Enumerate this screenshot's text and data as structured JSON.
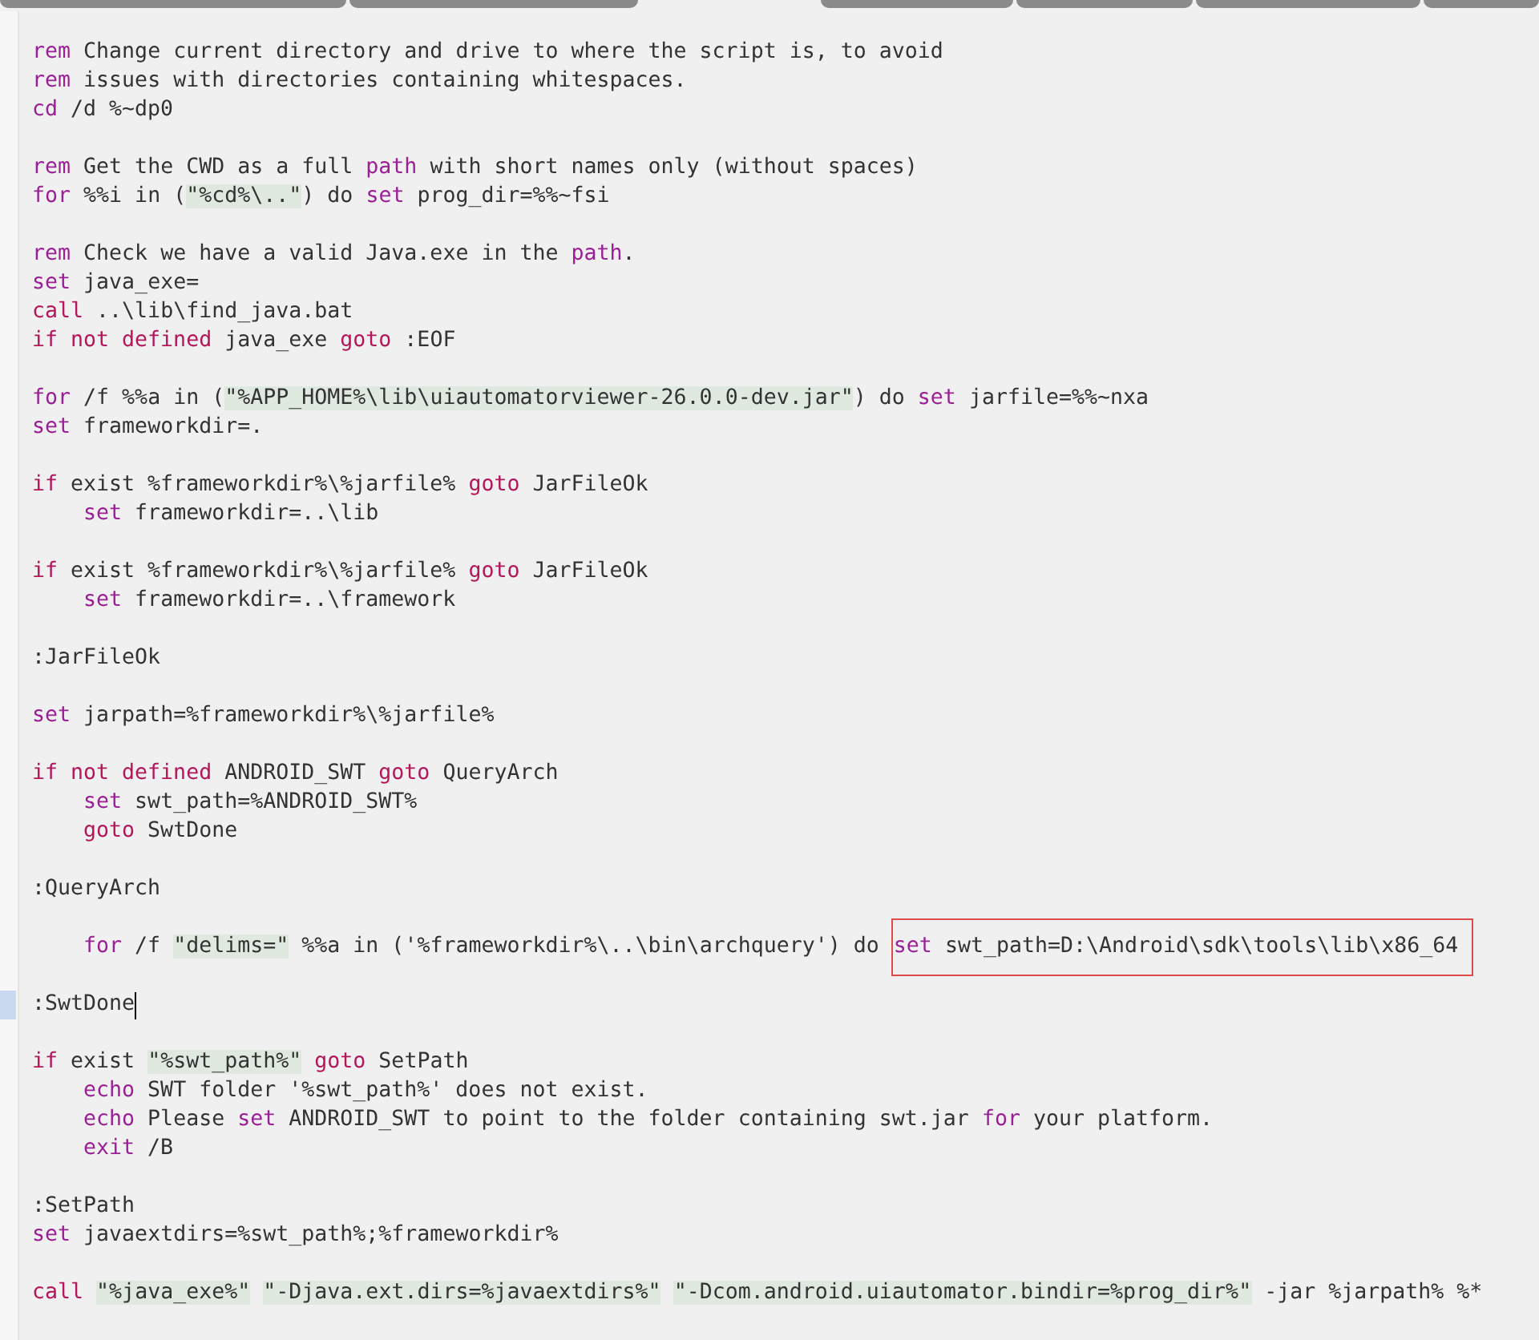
{
  "lines": [
    {
      "cursor": false,
      "indented": false,
      "tokens": [
        {
          "kind": "keyword",
          "text": "rem"
        },
        {
          "kind": "text",
          "text": " Change current directory and drive to where the script is, to avoid"
        }
      ]
    },
    {
      "cursor": false,
      "indented": false,
      "tokens": [
        {
          "kind": "keyword",
          "text": "rem"
        },
        {
          "kind": "text",
          "text": " issues with directories containing whitespaces."
        }
      ]
    },
    {
      "cursor": false,
      "indented": false,
      "tokens": [
        {
          "kind": "keyword",
          "text": "cd"
        },
        {
          "kind": "text",
          "text": " /d %~dp0"
        }
      ]
    },
    {
      "cursor": false
    },
    {
      "cursor": false,
      "indented": false,
      "tokens": [
        {
          "kind": "keyword",
          "text": "rem"
        },
        {
          "kind": "text",
          "text": " Get the CWD as a full "
        },
        {
          "kind": "keyword",
          "text": "path"
        },
        {
          "kind": "text",
          "text": " with short names only (without spaces)"
        }
      ]
    },
    {
      "cursor": false,
      "indented": false,
      "tokens": [
        {
          "kind": "keyword",
          "text": "for"
        },
        {
          "kind": "text",
          "text": " %%i in ("
        },
        {
          "kind": "string",
          "text": "\"%cd%\\..\"",
          "spaced": false
        },
        {
          "kind": "text",
          "text": ") do "
        },
        {
          "kind": "keyword",
          "text": "set"
        },
        {
          "kind": "text",
          "text": " prog_dir=%%~fsi"
        }
      ]
    },
    {
      "cursor": false
    },
    {
      "cursor": false,
      "indented": false,
      "tokens": [
        {
          "kind": "keyword",
          "text": "rem"
        },
        {
          "kind": "text",
          "text": " Check we have a valid Java.exe in the "
        },
        {
          "kind": "keyword",
          "text": "path"
        },
        {
          "kind": "text",
          "text": "."
        }
      ]
    },
    {
      "cursor": false,
      "indented": false,
      "tokens": [
        {
          "kind": "keyword",
          "text": "set"
        },
        {
          "kind": "text",
          "text": " java_exe="
        }
      ]
    },
    {
      "cursor": false,
      "indented": false,
      "tokens": [
        {
          "kind": "control",
          "text": "call"
        },
        {
          "kind": "text",
          "text": " ..\\lib\\find_java.bat"
        }
      ]
    },
    {
      "cursor": false,
      "indented": false,
      "tokens": [
        {
          "kind": "control",
          "text": "if not defined"
        },
        {
          "kind": "text",
          "text": " java_exe "
        },
        {
          "kind": "control",
          "text": "goto"
        },
        {
          "kind": "text",
          "text": " :EOF"
        }
      ]
    },
    {
      "cursor": false
    },
    {
      "cursor": false,
      "indented": false,
      "tokens": [
        {
          "kind": "keyword",
          "text": "for"
        },
        {
          "kind": "text",
          "text": " /f %%a in ("
        },
        {
          "kind": "string",
          "text": "\"%APP_HOME%\\lib\\uiautomatorviewer-26.0.0-dev.jar\"",
          "spaced": false
        },
        {
          "kind": "text",
          "text": ") do "
        },
        {
          "kind": "keyword",
          "text": "set"
        },
        {
          "kind": "text",
          "text": " jarfile=%%~nxa"
        }
      ]
    },
    {
      "cursor": false,
      "indented": false,
      "tokens": [
        {
          "kind": "keyword",
          "text": "set"
        },
        {
          "kind": "text",
          "text": " frameworkdir=."
        }
      ]
    },
    {
      "cursor": false
    },
    {
      "cursor": false,
      "indented": false,
      "tokens": [
        {
          "kind": "control",
          "text": "if"
        },
        {
          "kind": "text",
          "text": " exist %frameworkdir%\\%jarfile% "
        },
        {
          "kind": "control",
          "text": "goto"
        },
        {
          "kind": "text",
          "text": " JarFileOk"
        }
      ]
    },
    {
      "cursor": false,
      "indented": true,
      "tokens": [
        {
          "kind": "keyword",
          "text": "set"
        },
        {
          "kind": "text",
          "text": " frameworkdir=..\\lib"
        }
      ]
    },
    {
      "cursor": false
    },
    {
      "cursor": false,
      "indented": false,
      "tokens": [
        {
          "kind": "control",
          "text": "if"
        },
        {
          "kind": "text",
          "text": " exist %frameworkdir%\\%jarfile% "
        },
        {
          "kind": "control",
          "text": "goto"
        },
        {
          "kind": "text",
          "text": " JarFileOk"
        }
      ]
    },
    {
      "cursor": false,
      "indented": true,
      "tokens": [
        {
          "kind": "keyword",
          "text": "set"
        },
        {
          "kind": "text",
          "text": " frameworkdir=..\\framework"
        }
      ]
    },
    {
      "cursor": false
    },
    {
      "cursor": false,
      "indented": false,
      "tokens": [
        {
          "kind": "text",
          "text": ":JarFileOk"
        }
      ]
    },
    {
      "cursor": false
    },
    {
      "cursor": false,
      "indented": false,
      "tokens": [
        {
          "kind": "keyword",
          "text": "set"
        },
        {
          "kind": "text",
          "text": " jarpath=%frameworkdir%\\%jarfile%"
        }
      ]
    },
    {
      "cursor": false
    },
    {
      "cursor": false,
      "indented": false,
      "tokens": [
        {
          "kind": "control",
          "text": "if not defined"
        },
        {
          "kind": "text",
          "text": " ANDROID_SWT "
        },
        {
          "kind": "control",
          "text": "goto"
        },
        {
          "kind": "text",
          "text": " QueryArch"
        }
      ]
    },
    {
      "cursor": false,
      "indented": true,
      "tokens": [
        {
          "kind": "keyword",
          "text": "set"
        },
        {
          "kind": "text",
          "text": " swt_path=%ANDROID_SWT%"
        }
      ]
    },
    {
      "cursor": false,
      "indented": true,
      "tokens": [
        {
          "kind": "control",
          "text": "goto"
        },
        {
          "kind": "text",
          "text": " SwtDone"
        }
      ]
    },
    {
      "cursor": false
    },
    {
      "cursor": false,
      "indented": false,
      "tokens": [
        {
          "kind": "text",
          "text": ":QueryArch"
        }
      ]
    },
    {
      "cursor": false
    },
    {
      "cursor": false,
      "indented": true,
      "tokens": [
        {
          "kind": "keyword",
          "text": "for"
        },
        {
          "kind": "text",
          "text": " /f "
        },
        {
          "kind": "string",
          "text": "\"delims=\"",
          "spaced": false
        },
        {
          "kind": "text",
          "text": " %%a in ('%frameworkdir%\\..\\bin\\archquery') do "
        }
      ],
      "boxed_tokens": [
        {
          "kind": "keyword",
          "text": "set"
        },
        {
          "kind": "text",
          "text": " swt_path=D:\\Android\\sdk\\tools\\lib\\x86_64"
        }
      ]
    },
    {
      "cursor": false
    },
    {
      "cursor": true,
      "indented": false,
      "tokens": [
        {
          "kind": "text",
          "text": ":SwtDone"
        }
      ]
    },
    {
      "cursor": false
    },
    {
      "cursor": false,
      "indented": false,
      "tokens": [
        {
          "kind": "control",
          "text": "if"
        },
        {
          "kind": "text",
          "text": " exist "
        },
        {
          "kind": "string",
          "text": "\"%swt_path%\"",
          "spaced": false
        },
        {
          "kind": "control",
          "text": " goto"
        },
        {
          "kind": "text",
          "text": " SetPath"
        }
      ]
    },
    {
      "cursor": false,
      "indented": true,
      "tokens": [
        {
          "kind": "keyword",
          "text": "echo"
        },
        {
          "kind": "text",
          "text": " SWT folder '%swt_path%' does not exist."
        }
      ]
    },
    {
      "cursor": false,
      "indented": true,
      "tokens": [
        {
          "kind": "keyword",
          "text": "echo"
        },
        {
          "kind": "text",
          "text": " Please "
        },
        {
          "kind": "keyword",
          "text": "set"
        },
        {
          "kind": "text",
          "text": " ANDROID_SWT to point to the folder containing swt.jar "
        },
        {
          "kind": "keyword",
          "text": "for"
        },
        {
          "kind": "text",
          "text": " your platform."
        }
      ]
    },
    {
      "cursor": false,
      "indented": true,
      "tokens": [
        {
          "kind": "keyword",
          "text": "exit"
        },
        {
          "kind": "text",
          "text": " /B"
        }
      ]
    },
    {
      "cursor": false
    },
    {
      "cursor": false,
      "indented": false,
      "tokens": [
        {
          "kind": "text",
          "text": ":SetPath"
        }
      ]
    },
    {
      "cursor": false,
      "indented": false,
      "tokens": [
        {
          "kind": "keyword",
          "text": "set"
        },
        {
          "kind": "text",
          "text": " javaextdirs=%swt_path%;%frameworkdir%"
        }
      ]
    },
    {
      "cursor": false
    },
    {
      "cursor": false,
      "indented": false,
      "tokens": [
        {
          "kind": "control",
          "text": "call"
        },
        {
          "kind": "string",
          "text": "\"%java_exe%\"",
          "spaced": true
        },
        {
          "kind": "string",
          "text": "\"-Djava.ext.dirs=%javaextdirs%\"",
          "spaced": true
        },
        {
          "kind": "string",
          "text": "\"-Dcom.android.uiautomator.bindir=%prog_dir%\"",
          "spaced": true
        },
        {
          "kind": "text",
          "text": " -jar %jarpath% %*"
        }
      ]
    }
  ]
}
